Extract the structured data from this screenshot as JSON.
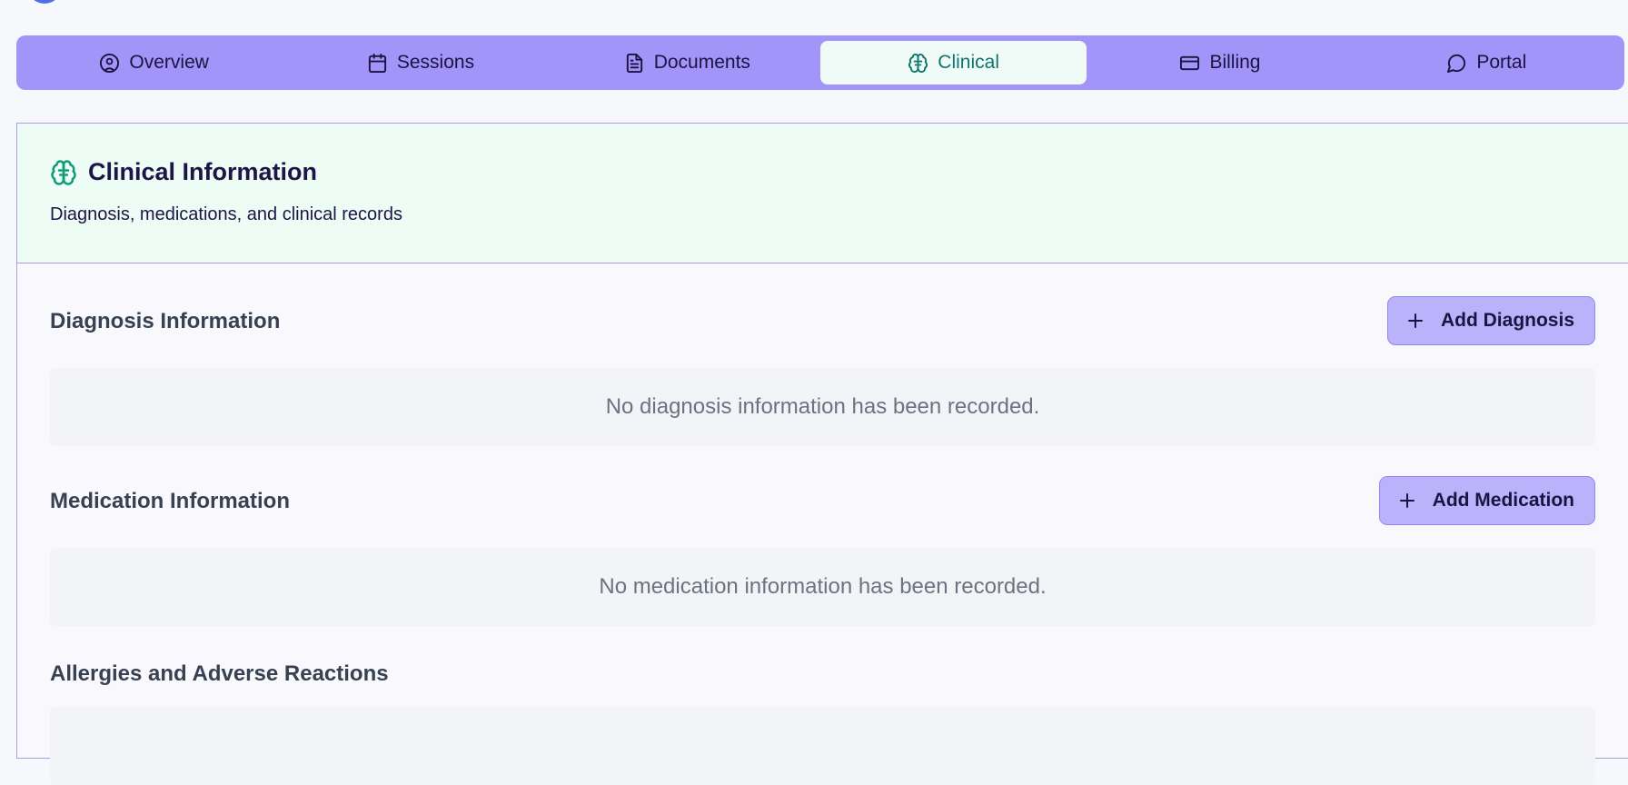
{
  "tabs": [
    {
      "label": "Overview",
      "icon": "user-circle-icon"
    },
    {
      "label": "Sessions",
      "icon": "calendar-icon"
    },
    {
      "label": "Documents",
      "icon": "document-icon"
    },
    {
      "label": "Clinical",
      "icon": "brain-icon",
      "active": true
    },
    {
      "label": "Billing",
      "icon": "credit-card-icon"
    },
    {
      "label": "Portal",
      "icon": "chat-bubble-icon"
    }
  ],
  "panel": {
    "title": "Clinical Information",
    "subtitle": "Diagnosis, medications, and clinical records",
    "icon": "brain-icon"
  },
  "sections": {
    "diagnosis": {
      "title": "Diagnosis Information",
      "button": "Add Diagnosis",
      "empty": "No diagnosis information has been recorded."
    },
    "medication": {
      "title": "Medication Information",
      "button": "Add Medication",
      "empty": "No medication information has been recorded."
    },
    "allergies": {
      "title": "Allergies and Adverse Reactions"
    }
  },
  "colors": {
    "tabbar": "#a294f9",
    "active_tab_bg": "#f0fbf7",
    "active_tab_text": "#0f766e",
    "header_bg": "#edfcf4",
    "button_bg": "#bab2fb"
  }
}
